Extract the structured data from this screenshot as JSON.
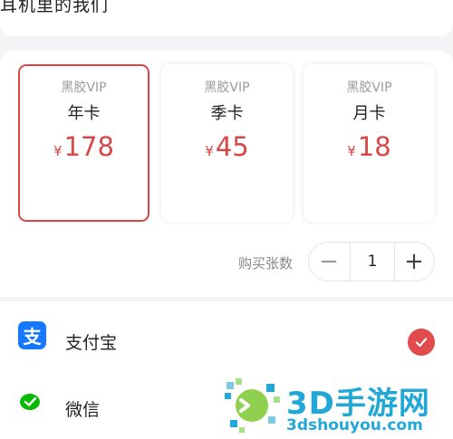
{
  "header": {
    "title": "耳机里的我们"
  },
  "plans": [
    {
      "brand": "黑胶VIP",
      "name": "年卡",
      "currency": "¥",
      "price": "178",
      "selected": true
    },
    {
      "brand": "黑胶VIP",
      "name": "季卡",
      "currency": "¥",
      "price": "45",
      "selected": false
    },
    {
      "brand": "黑胶VIP",
      "name": "月卡",
      "currency": "¥",
      "price": "18",
      "selected": false
    }
  ],
  "quantity": {
    "label": "购买张数",
    "value": "1",
    "minus": "−",
    "plus": "+"
  },
  "payment": [
    {
      "label": "支付宝",
      "icon": "alipay-icon",
      "icon_glyph": "支",
      "icon_color": "#1677ff",
      "selected": true
    },
    {
      "label": "微信",
      "icon": "wechat-icon",
      "icon_color": "#09bb07",
      "selected": false
    }
  ],
  "watermark": {
    "text": "3D手游网",
    "url": "3dshouyou.com"
  },
  "colors": {
    "accent": "#d94646",
    "check": "#e24b4b",
    "watermark": "#21a8d6"
  }
}
